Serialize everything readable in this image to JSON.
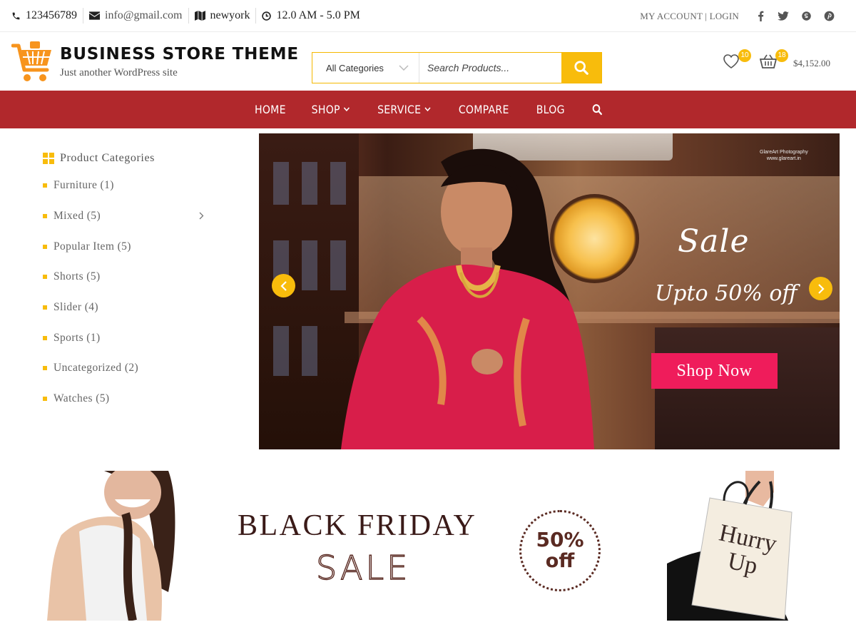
{
  "topbar": {
    "phone": "123456789",
    "email": "info@gmail.com",
    "location": "newyork",
    "hours": "12.0 AM - 5.0 PM",
    "account": "MY ACCOUNT",
    "login": "LOGIN",
    "social_icons": [
      "facebook-icon",
      "twitter-icon",
      "skype-icon",
      "pinterest-icon"
    ]
  },
  "header": {
    "site_title": "BUSINESS STORE THEME",
    "tagline": "Just another WordPress site",
    "search": {
      "category": "All Categories",
      "placeholder": "Search Products..."
    },
    "wishlist_count": "10",
    "cart_count": "18",
    "cart_total": "$4,152.00"
  },
  "nav": {
    "items": [
      {
        "label": "HOME",
        "dropdown": false
      },
      {
        "label": "SHOP",
        "dropdown": true
      },
      {
        "label": "SERVICE",
        "dropdown": true
      },
      {
        "label": "COMPARE",
        "dropdown": false
      },
      {
        "label": "BLOG",
        "dropdown": false
      }
    ]
  },
  "sidebar": {
    "heading": "Product Categories",
    "items": [
      {
        "label": "Furniture (1)"
      },
      {
        "label": "Mixed (5)"
      },
      {
        "label": "Popular Item (5)"
      },
      {
        "label": "Shorts (5)"
      },
      {
        "label": "Slider (4)"
      },
      {
        "label": "Sports (1)"
      },
      {
        "label": "Uncategorized (2)"
      },
      {
        "label": "Watches (5)"
      }
    ]
  },
  "slider": {
    "credit_line1": "GlareArt Photography",
    "credit_line2": "www.glareart.in",
    "title": "Sale",
    "subtitle": "Upto 50% off",
    "button": "Shop Now"
  },
  "banner": {
    "title": "BLACK FRIDAY",
    "sale": "SALE",
    "percent": "50%",
    "off": "off",
    "bag_line1": "Hurry",
    "bag_line2": "Up"
  },
  "colors": {
    "accent": "#f8bc0c",
    "nav": "#b1282c",
    "cta": "#ef1c5b",
    "banner_brown": "#5a2a22"
  }
}
